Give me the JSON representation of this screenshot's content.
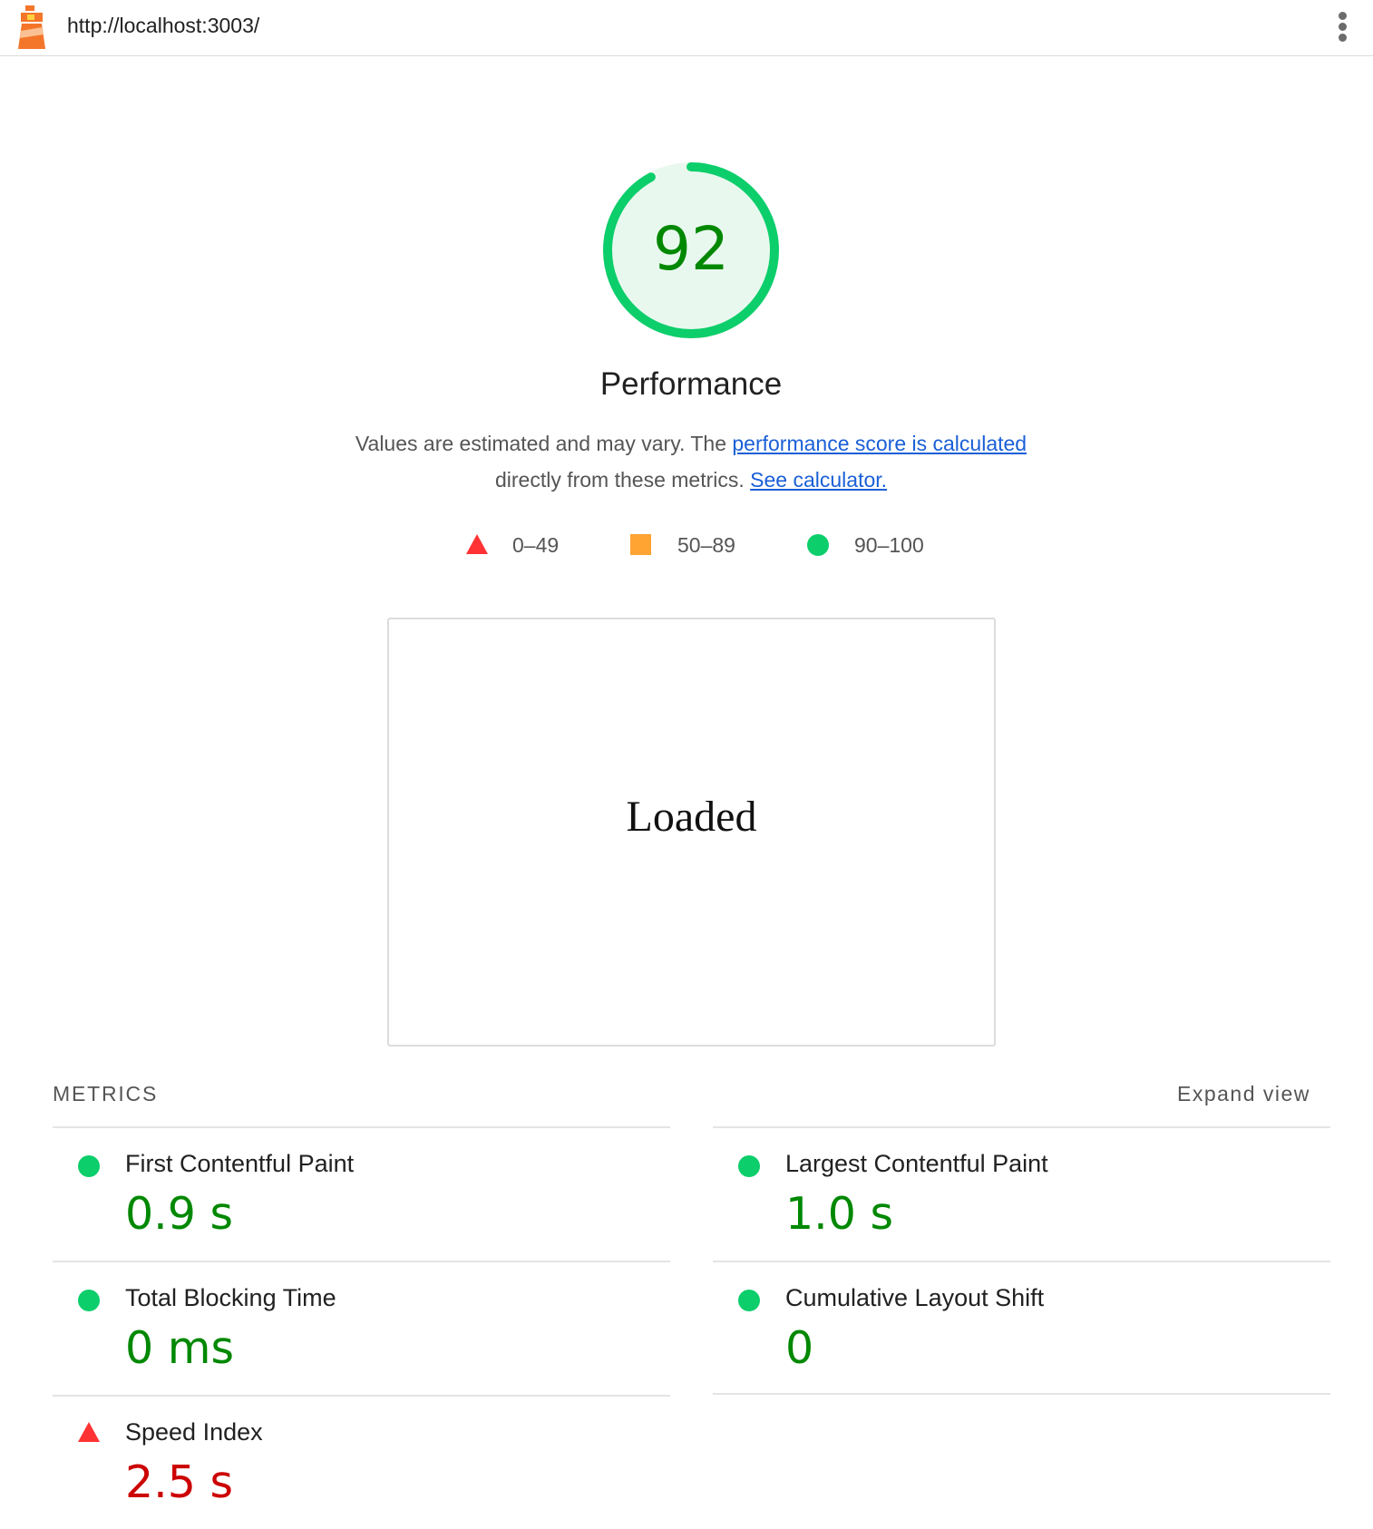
{
  "header": {
    "url": "http://localhost:3003/"
  },
  "gauge": {
    "score": "92",
    "score_fraction": 0.92,
    "title": "Performance",
    "ring_color": "#0cce6b",
    "fill_color": "#e9f8ef",
    "score_color": "#008800"
  },
  "description": {
    "text_before": "Values are estimated and may vary. The ",
    "link1": "performance score is calculated",
    "text_middle": "directly from these metrics. ",
    "link2": "See calculator."
  },
  "legend": [
    {
      "shape": "triangle",
      "color": "#ff3333",
      "label": "0–49"
    },
    {
      "shape": "square",
      "color": "#ffa333",
      "label": "50–89"
    },
    {
      "shape": "circle",
      "color": "#0cce6b",
      "label": "90–100"
    }
  ],
  "screenshot": {
    "text": "Loaded"
  },
  "metrics": {
    "header": "METRICS",
    "expand_label": "Expand view",
    "items": [
      {
        "name": "First Contentful Paint",
        "value": "0.9 s",
        "status": "pass"
      },
      {
        "name": "Largest Contentful Paint",
        "value": "1.0 s",
        "status": "pass"
      },
      {
        "name": "Total Blocking Time",
        "value": "0 ms",
        "status": "pass"
      },
      {
        "name": "Cumulative Layout Shift",
        "value": "0",
        "status": "pass"
      },
      {
        "name": "Speed Index",
        "value": "2.5 s",
        "status": "fail"
      }
    ]
  },
  "colors": {
    "pass": "#0cce6b",
    "fail": "#ff3333",
    "link": "#1a5fd6"
  }
}
